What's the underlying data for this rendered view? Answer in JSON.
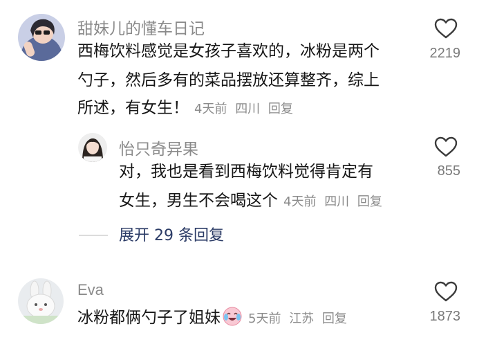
{
  "comments": [
    {
      "username": "甜妹儿的懂车日记",
      "lines": [
        "西梅饮料感觉是女孩子喜欢的，冰粉是两个",
        "勺子，然后多有的菜品摆放还算整齐，综上",
        "所述，有女生！"
      ],
      "time": "4天前",
      "location": "四川",
      "reply_label": "回复",
      "like_count": "2219",
      "avatar_icon": "user-avatar-sunglasses-icon"
    },
    {
      "username": "怡只奇异果",
      "lines": [
        "对，我也是看到西梅饮料觉得肯定有",
        "女生，男生不会喝这个"
      ],
      "time": "4天前",
      "location": "四川",
      "reply_label": "回复",
      "like_count": "855",
      "avatar_icon": "user-avatar-girl-icon"
    },
    {
      "username": "Eva",
      "lines": [
        "冰粉都俩勺子了姐妹"
      ],
      "time": "5天前",
      "location": "江苏",
      "reply_label": "回复",
      "like_count": "1873",
      "avatar_icon": "user-avatar-rabbit-icon",
      "emoji_icon": "crying-laughing-emoji-icon"
    }
  ],
  "expand_replies_label": "展开 29 条回复",
  "colors": {
    "meta_gray": "#8a8a8a",
    "expand_blue": "#2b3b66",
    "text_dark": "#161616"
  }
}
